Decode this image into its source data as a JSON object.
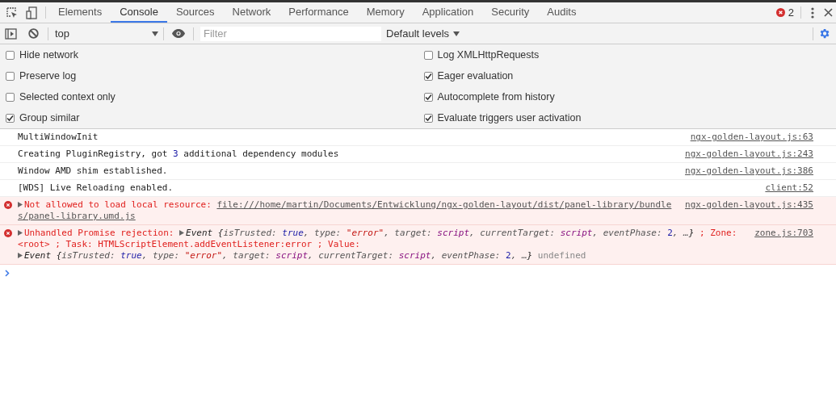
{
  "tabs": [
    {
      "label": "Elements",
      "selected": false
    },
    {
      "label": "Console",
      "selected": true
    },
    {
      "label": "Sources",
      "selected": false
    },
    {
      "label": "Network",
      "selected": false
    },
    {
      "label": "Performance",
      "selected": false
    },
    {
      "label": "Memory",
      "selected": false
    },
    {
      "label": "Application",
      "selected": false
    },
    {
      "label": "Security",
      "selected": false
    },
    {
      "label": "Audits",
      "selected": false
    }
  ],
  "error_count": "2",
  "toolbar": {
    "context": "top",
    "filter": {
      "placeholder": "Filter"
    },
    "levels": "Default levels"
  },
  "settings": {
    "left": [
      {
        "label": "Hide network",
        "checked": false
      },
      {
        "label": "Preserve log",
        "checked": false
      },
      {
        "label": "Selected context only",
        "checked": false
      },
      {
        "label": "Group similar",
        "checked": true
      }
    ],
    "right": [
      {
        "label": "Log XMLHttpRequests",
        "checked": false
      },
      {
        "label": "Eager evaluation",
        "checked": true
      },
      {
        "label": "Autocomplete from history",
        "checked": true
      },
      {
        "label": "Evaluate triggers user activation",
        "checked": true
      }
    ]
  },
  "messages": [
    {
      "kind": "log",
      "source": "ngx-golden-layout.js:63",
      "parts": [
        {
          "kind": "plain",
          "text": "MultiWindowInit"
        }
      ]
    },
    {
      "kind": "log",
      "source": "ngx-golden-layout.js:243",
      "parts": [
        {
          "kind": "plain",
          "text": "Creating PluginRegistry, got "
        },
        {
          "kind": "number",
          "text": "3"
        },
        {
          "kind": "plain",
          "text": " additional dependency modules"
        }
      ]
    },
    {
      "kind": "log",
      "source": "ngx-golden-layout.js:386",
      "parts": [
        {
          "kind": "plain",
          "text": "Window AMD shim established."
        }
      ]
    },
    {
      "kind": "log",
      "source": "client:52",
      "parts": [
        {
          "kind": "plain",
          "text": "[WDS] Live Reloading enabled."
        }
      ]
    },
    {
      "kind": "error",
      "source": "ngx-golden-layout.js:435",
      "parts": [
        {
          "kind": "toggle"
        },
        {
          "kind": "error",
          "text": "Not allowed to load local resource: "
        },
        {
          "kind": "link",
          "text": "file:///home/martin/Documents/Entwicklung/ngx-golden-layout/dist/panel-library/bundles/panel-library.umd.js"
        }
      ]
    },
    {
      "kind": "error",
      "source": "zone.js:703",
      "parts": [
        {
          "kind": "toggle"
        },
        {
          "kind": "error",
          "text": "Unhandled Promise rejection: "
        },
        {
          "kind": "toggle"
        },
        {
          "kind": "object",
          "text": "Event {"
        },
        {
          "kind": "key",
          "text": "isTrusted: "
        },
        {
          "kind": "keyword",
          "text": "true"
        },
        {
          "kind": "key",
          "text": ", type: "
        },
        {
          "kind": "string",
          "text": "\"error\""
        },
        {
          "kind": "key",
          "text": ", target: "
        },
        {
          "kind": "ident",
          "text": "script"
        },
        {
          "kind": "key",
          "text": ", currentTarget: "
        },
        {
          "kind": "ident",
          "text": "script"
        },
        {
          "kind": "key",
          "text": ", eventPhase: "
        },
        {
          "kind": "number",
          "text": "2"
        },
        {
          "kind": "key",
          "text": ", …"
        },
        {
          "kind": "object",
          "text": "}"
        },
        {
          "kind": "error",
          "text": " ; Zone: <root> ; Task: HTMLScriptElement.addEventListener:error ; Value: "
        },
        {
          "kind": "break"
        },
        {
          "kind": "toggle"
        },
        {
          "kind": "object",
          "text": "Event {"
        },
        {
          "kind": "key",
          "text": "isTrusted: "
        },
        {
          "kind": "keyword",
          "text": "true"
        },
        {
          "kind": "key",
          "text": ", type: "
        },
        {
          "kind": "string",
          "text": "\"error\""
        },
        {
          "kind": "key",
          "text": ", target: "
        },
        {
          "kind": "ident",
          "text": "script"
        },
        {
          "kind": "key",
          "text": ", currentTarget: "
        },
        {
          "kind": "ident",
          "text": "script"
        },
        {
          "kind": "key",
          "text": ", eventPhase: "
        },
        {
          "kind": "number",
          "text": "2"
        },
        {
          "kind": "key",
          "text": ", …"
        },
        {
          "kind": "object",
          "text": "}"
        },
        {
          "kind": "gray",
          "text": " undefined"
        }
      ]
    }
  ]
}
